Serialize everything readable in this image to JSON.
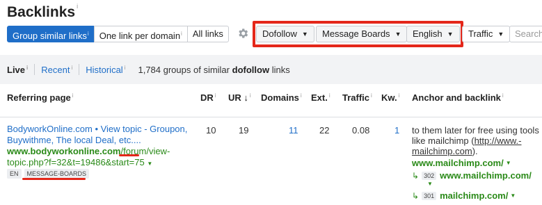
{
  "header": {
    "title": "Backlinks",
    "info": "i"
  },
  "segment": [
    {
      "label": "Group similar links",
      "info": "i"
    },
    {
      "label": "One link per domain",
      "info": "i"
    },
    {
      "label": "All links"
    }
  ],
  "filters": {
    "link_type": "Dofollow",
    "category": "Message Boards",
    "language": "English",
    "traffic": "Traffic"
  },
  "search": {
    "placeholder": "Search"
  },
  "tabs": {
    "live": "Live",
    "recent": "Recent",
    "historical": "Historical",
    "info": "i"
  },
  "summary": {
    "prefix": "1,784 groups of similar",
    "bold": "dofollow",
    "suffix": "links"
  },
  "columns": {
    "referring_page": "Referring page",
    "dr": "DR",
    "ur": "UR",
    "ur_sort": "↓",
    "domains": "Domains",
    "ext": "Ext.",
    "traffic": "Traffic",
    "kw": "Kw.",
    "anchor": "Anchor and backlink",
    "info": "i"
  },
  "row": {
    "title": "BodyworkOnline.com • View topic - Groupon, Buywithme, The local Deal, etc....",
    "url_bold": "www.bodyworkonline.com",
    "url_rest": "/forum/view-topic.php?f=32&t=19486&start=75",
    "lang_tag": "EN",
    "category_tag": "MESSAGE-BOARDS",
    "dr": "10",
    "ur": "19",
    "domains": "11",
    "ext": "22",
    "traffic": "0.08",
    "kw": "1",
    "anchor_text": "to them later for free using tools like mailchimp (",
    "anchor_link": "http://www.-mailchimp.com",
    "anchor_close": ").",
    "backlink": "www.mailchimp.com/",
    "redirects": [
      {
        "code": "302",
        "url": "www.mailchimp.com/"
      },
      {
        "code": "301",
        "url": "mailchimp.com/"
      }
    ]
  },
  "colors": {
    "accent": "#1f6ec8",
    "link_green": "#2a8a18",
    "highlight_red": "#e4271a"
  }
}
